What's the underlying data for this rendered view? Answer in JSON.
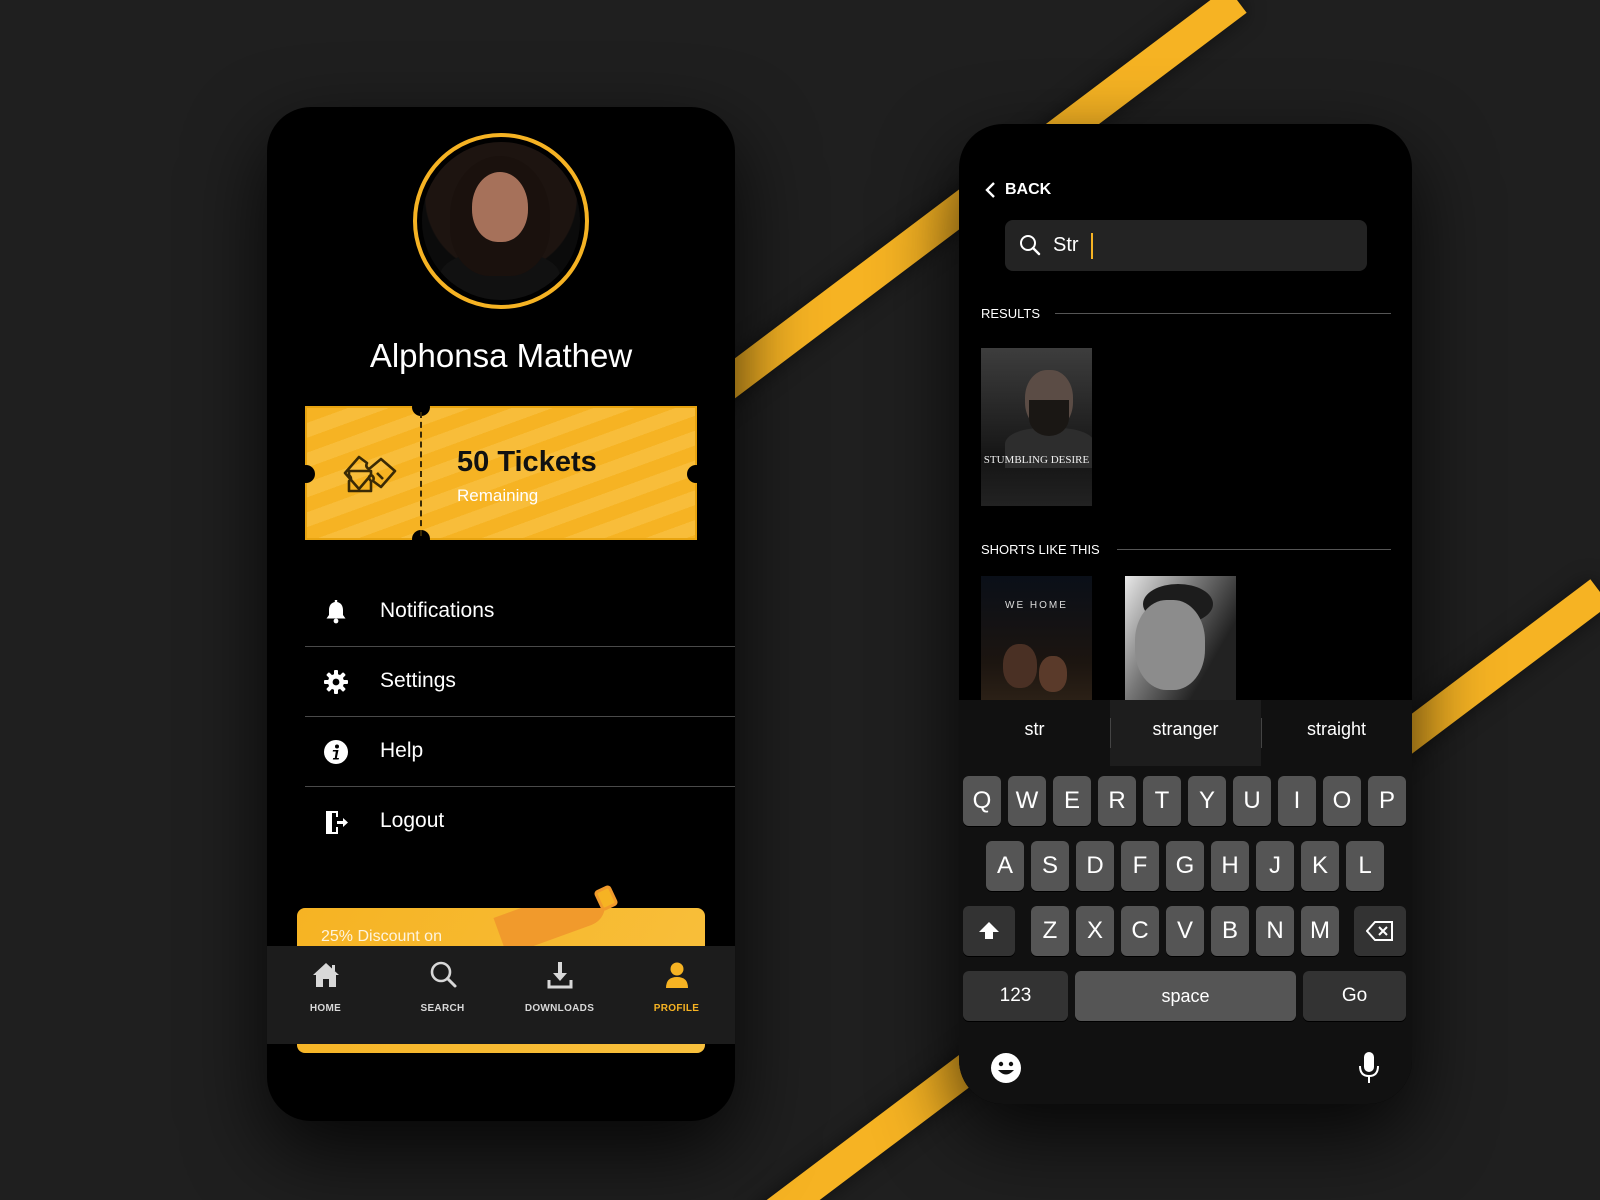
{
  "colors": {
    "accent": "#f6b323",
    "background": "#1f1f1f",
    "phone": "#000000"
  },
  "profile": {
    "name": "Alphonsa Mathew",
    "avatar_icon": "user-avatar-photo",
    "tickets": {
      "count_label": "50 Tickets",
      "sub_label": "Remaining",
      "icon": "tickets-icon"
    },
    "menu": [
      {
        "label": "Notifications",
        "icon": "bell-icon"
      },
      {
        "label": "Settings",
        "icon": "gear-icon"
      },
      {
        "label": "Help",
        "icon": "info-icon"
      },
      {
        "label": "Logout",
        "icon": "logout-icon"
      }
    ],
    "promo_text": "25% Discount on",
    "tabs": [
      {
        "label": "HOME",
        "icon": "home-icon",
        "active": false
      },
      {
        "label": "SEARCH",
        "icon": "search-icon",
        "active": false
      },
      {
        "label": "DOWNLOADS",
        "icon": "download-icon",
        "active": false
      },
      {
        "label": "PROFILE",
        "icon": "person-icon",
        "active": true
      }
    ]
  },
  "search_screen": {
    "back_label": "BACK",
    "query": "Str",
    "results_label": "RESULTS",
    "results": [
      {
        "title": "STUMBLING DESIRE"
      }
    ],
    "shorts_label": "SHORTS LIKE THIS",
    "shorts": [
      {
        "title": "WE HOME"
      },
      {
        "title": ""
      }
    ],
    "suggestions": [
      "str",
      "stranger",
      "straight"
    ],
    "keyboard": {
      "row1": [
        "Q",
        "W",
        "E",
        "R",
        "T",
        "Y",
        "U",
        "I",
        "O",
        "P"
      ],
      "row2": [
        "A",
        "S",
        "D",
        "F",
        "G",
        "H",
        "J",
        "K",
        "L"
      ],
      "row3": [
        "Z",
        "X",
        "C",
        "V",
        "B",
        "N",
        "M"
      ],
      "numbers_key": "123",
      "space_key": "space",
      "go_key": "Go"
    }
  }
}
